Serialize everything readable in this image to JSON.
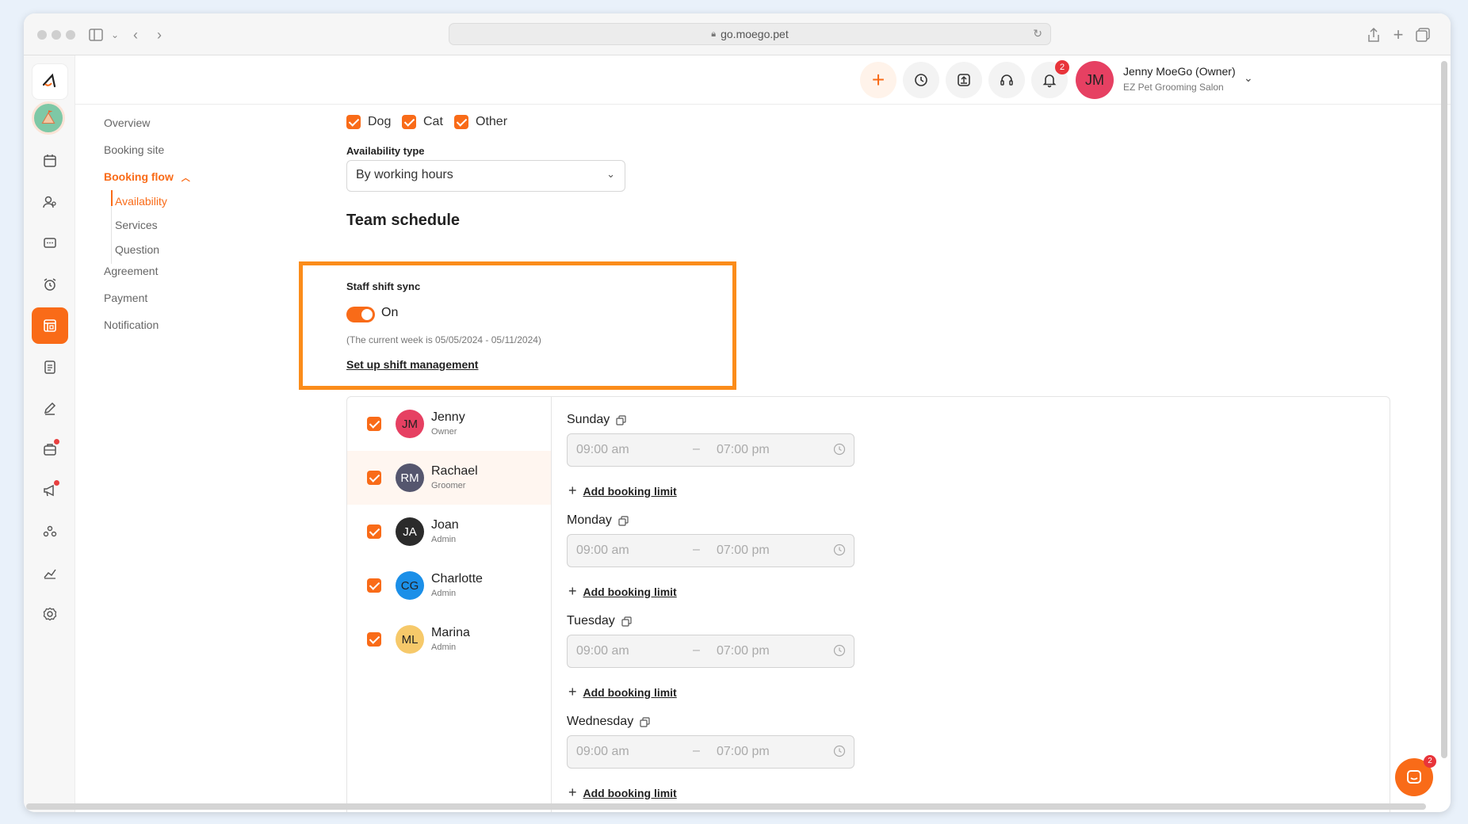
{
  "browser": {
    "url": "go.moego.pet"
  },
  "header": {
    "user_name": "Jenny MoeGo (Owner)",
    "business_name": "EZ Pet Grooming Salon",
    "user_initials": "JM",
    "notification_count": "2"
  },
  "subnav": {
    "items": [
      "Overview",
      "Booking site",
      "Booking flow",
      "Agreement",
      "Payment",
      "Notification"
    ],
    "booking_flow_children": [
      "Availability",
      "Services",
      "Question"
    ]
  },
  "pet_types": [
    "Dog",
    "Cat",
    "Other"
  ],
  "availability": {
    "label": "Availability type",
    "value": "By working hours"
  },
  "team_schedule": {
    "title": "Team schedule",
    "sync_label": "Staff shift sync",
    "toggle_state": "On",
    "week_note": "(The current week is 05/05/2024 - 05/11/2024)",
    "setup_link": "Set up shift management"
  },
  "staff": [
    {
      "initials": "JM",
      "name": "Jenny",
      "role": "Owner",
      "color": "#e64062"
    },
    {
      "initials": "RM",
      "name": "Rachael",
      "role": "Groomer",
      "color": "#55566e"
    },
    {
      "initials": "JA",
      "name": "Joan",
      "role": "Admin",
      "color": "#2b2b2b"
    },
    {
      "initials": "CG",
      "name": "Charlotte",
      "role": "Admin",
      "color": "#1b8fe8"
    },
    {
      "initials": "ML",
      "name": "Marina",
      "role": "Admin",
      "color": "#f6c96a"
    }
  ],
  "days": [
    {
      "name": "Sunday",
      "start": "09:00 am",
      "end": "07:00 pm",
      "limit_label": "Add booking limit"
    },
    {
      "name": "Monday",
      "start": "09:00 am",
      "end": "07:00 pm",
      "limit_label": "Add booking limit"
    },
    {
      "name": "Tuesday",
      "start": "09:00 am",
      "end": "07:00 pm",
      "limit_label": "Add booking limit"
    },
    {
      "name": "Wednesday",
      "start": "09:00 am",
      "end": "07:00 pm",
      "limit_label": "Add booking limit"
    }
  ],
  "chat_badge": "2",
  "colors": {
    "accent": "#f96b18",
    "highlight": "#fb8c1a"
  }
}
